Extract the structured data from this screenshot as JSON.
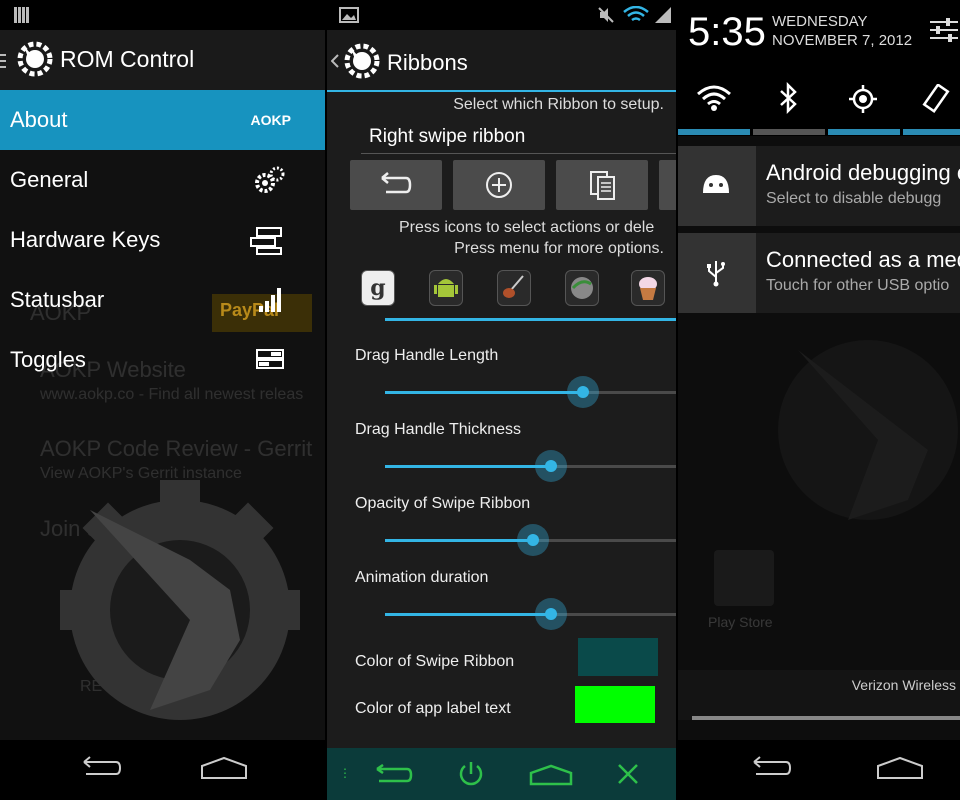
{
  "panel1": {
    "title": "ROM Control",
    "about_badge": "AOKP",
    "menu": [
      {
        "label": "About"
      },
      {
        "label": "General"
      },
      {
        "label": "Hardware Keys"
      },
      {
        "label": "Statusbar"
      },
      {
        "label": "Toggles"
      }
    ],
    "background_text": {
      "line1": "AOKP",
      "line2": "AOKP Website",
      "line3": "www.aokp.co - Find all newest releas",
      "line4": "AOKP Code Review - Gerrit",
      "line5": "View AOKP's Gerrit instance",
      "line6": "Join us",
      "line7": "REW",
      "paypal": "PayPal"
    }
  },
  "panel2": {
    "title": "Ribbons",
    "subtitle": "Select which Ribbon to setup.",
    "ribbon_selected": "Right swipe ribbon",
    "instructions1": "Press icons to select actions or dele",
    "instructions2": "Press menu for more options.",
    "sliders": [
      {
        "label": "Drag Handle Length",
        "value": 0.68
      },
      {
        "label": "Drag Handle Thickness",
        "value": 0.57
      },
      {
        "label": "Opacity of Swipe Ribbon",
        "value": 0.51
      },
      {
        "label": "Animation duration",
        "value": 0.57
      }
    ],
    "color_swipe_label": "Color of Swipe Ribbon",
    "color_swipe": "#0a4a4a",
    "color_label_text": "Color of app label text",
    "color_label": "#00ff00",
    "accent": "#33b5e5",
    "ribbon_nav_color": "#2ec04a",
    "ribbon_bar_bg": "#0b3b3a"
  },
  "panel3": {
    "time": "5:35",
    "day": "WEDNESDAY",
    "date": "NOVEMBER 7, 2012",
    "notifications": [
      {
        "title": "Android debugging e",
        "subtitle": "Select to disable debugg"
      },
      {
        "title": "Connected as a med",
        "subtitle": "Touch for other USB optio"
      }
    ],
    "carrier": "Verizon Wireless",
    "bg_app": "Play Store"
  }
}
